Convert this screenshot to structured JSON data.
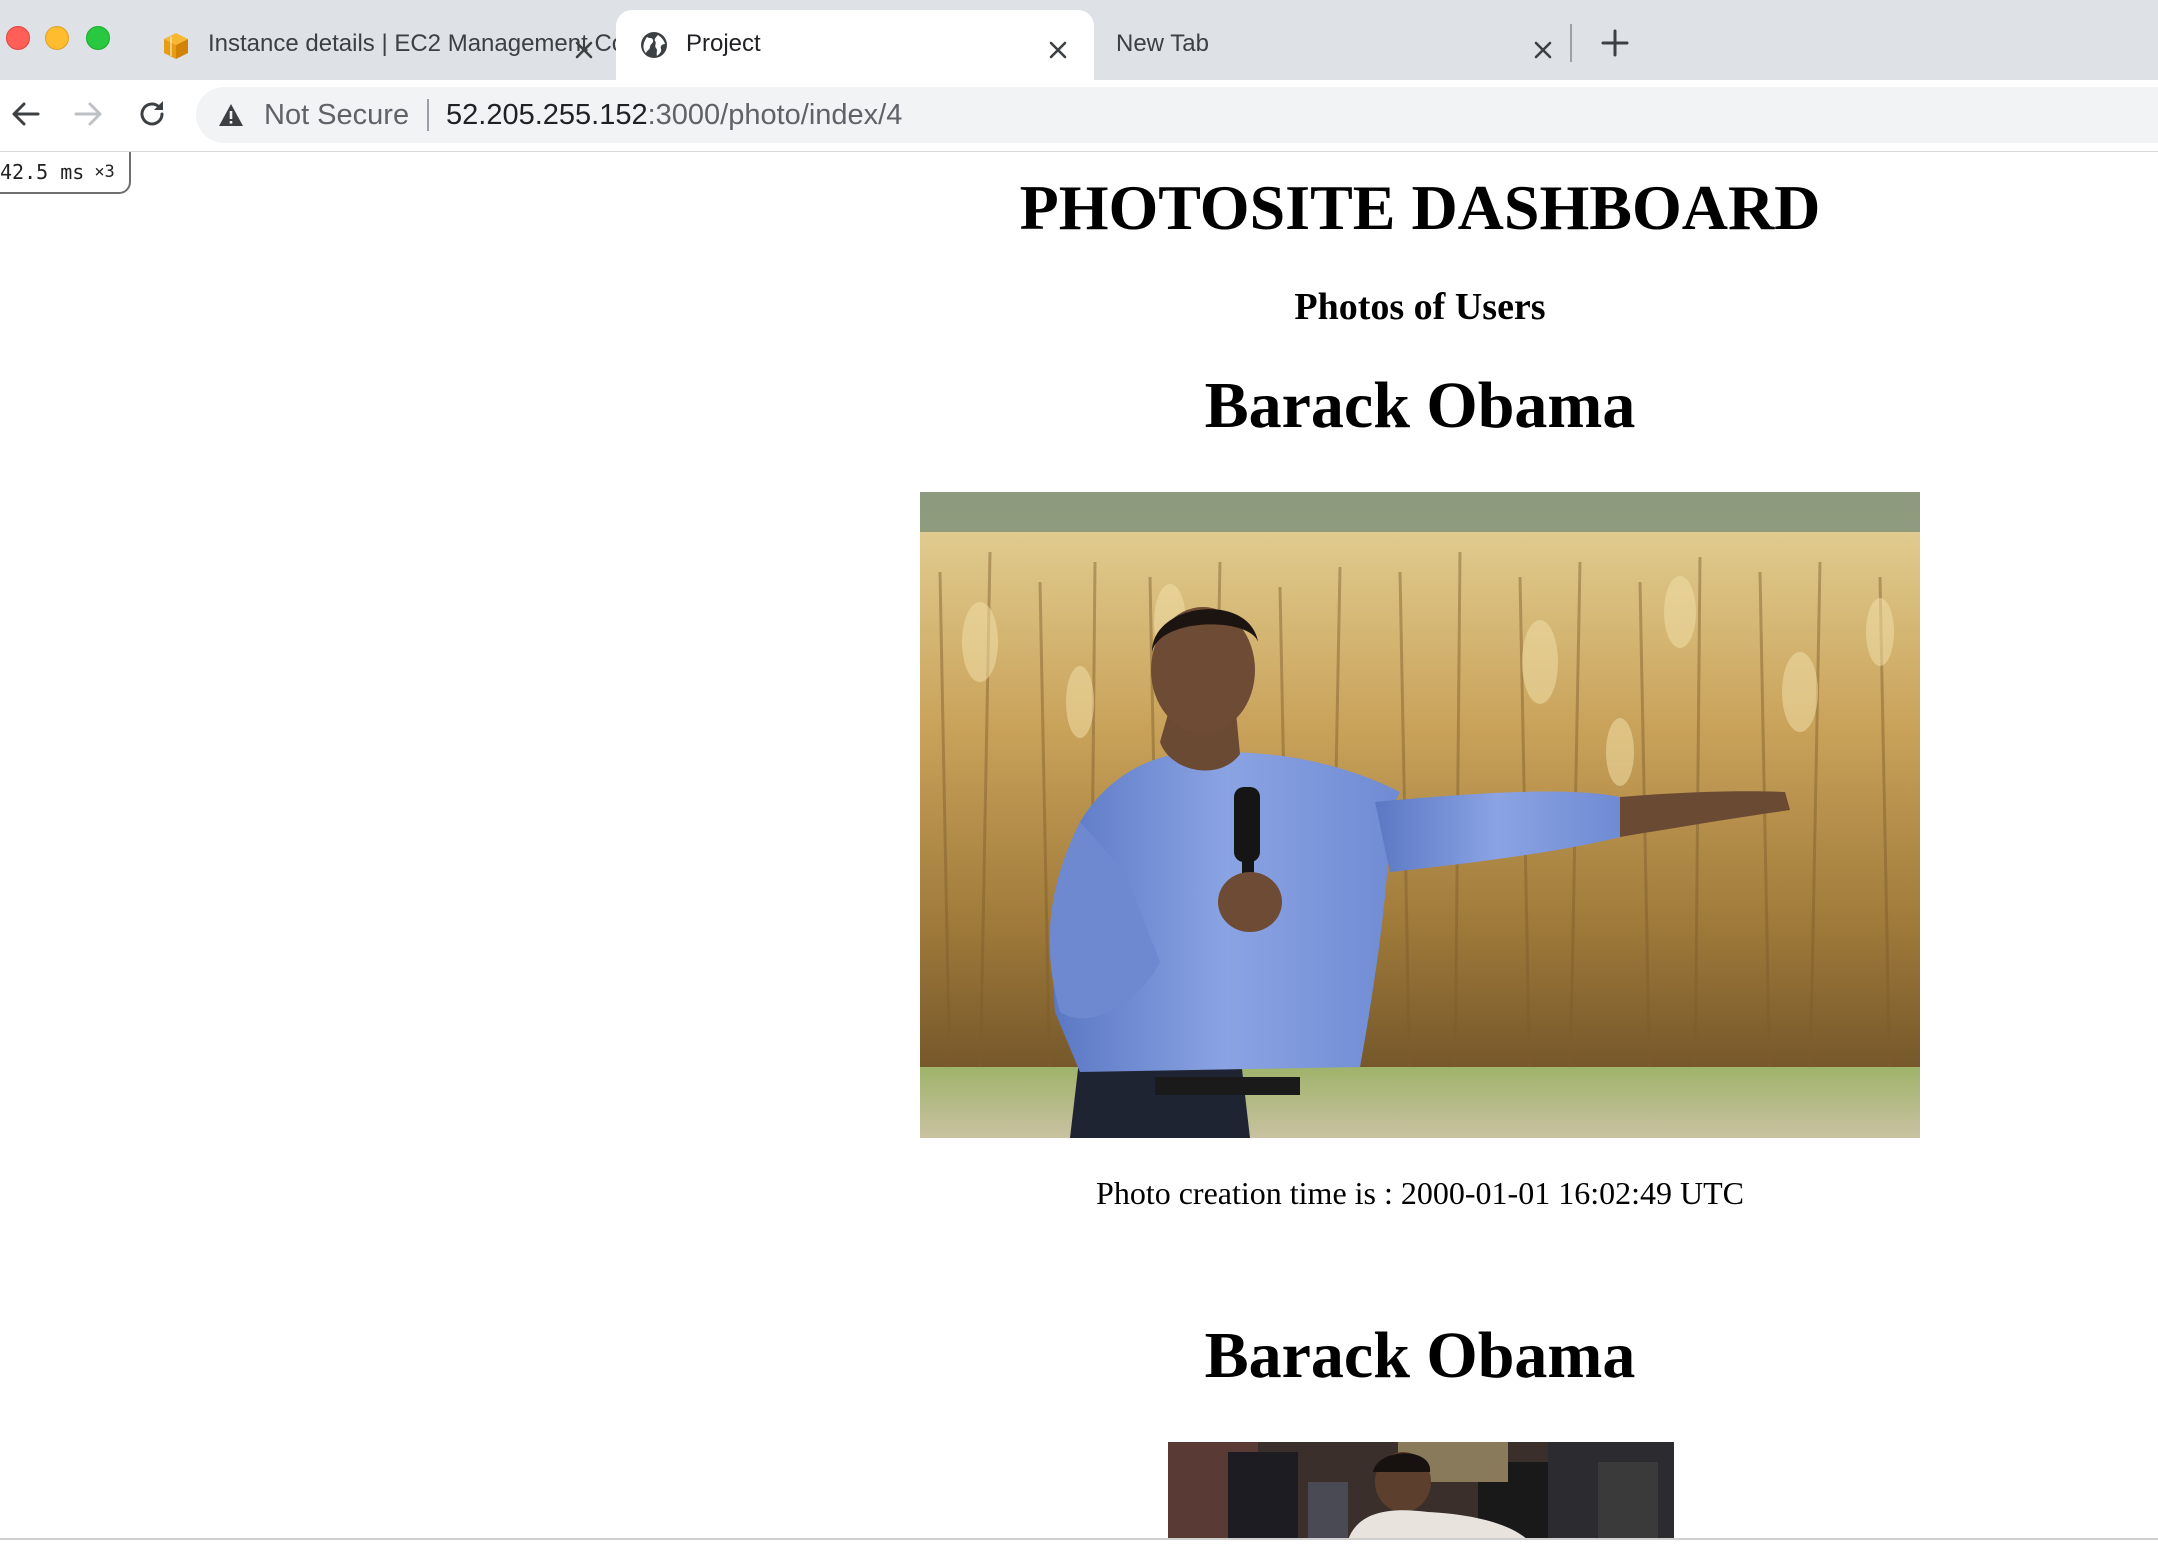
{
  "browser": {
    "tabs": [
      {
        "label": "Instance details | EC2 Management Console",
        "favicon": "aws-cube-icon",
        "active": false
      },
      {
        "label": "Project",
        "favicon": "globe-icon",
        "active": true
      },
      {
        "label": "New Tab",
        "favicon": "",
        "active": false
      }
    ],
    "omnibox": {
      "security_label": "Not Secure",
      "url_host": "52.205.255.152",
      "url_rest": ":3000/photo/index/4"
    }
  },
  "timing_badge": {
    "value": "42.5",
    "unit": "ms",
    "multiplier": "×3"
  },
  "page": {
    "title": "PHOTOSITE DASHBOARD",
    "subtitle": "Photos of Users",
    "photos": [
      {
        "user": "Barack Obama",
        "caption": "Photo creation time is : 2000-01-01 16:02:49 UTC",
        "alt": "Barack Obama speaking into a microphone in front of a cornfield"
      },
      {
        "user": "Barack Obama",
        "caption": "",
        "alt": "Barack Obama in a crowd"
      }
    ]
  },
  "colors": {
    "tabstrip": "#dee1e6",
    "active_tab": "#ffffff",
    "omnibox": "#f1f3f4",
    "text": "#000000"
  }
}
